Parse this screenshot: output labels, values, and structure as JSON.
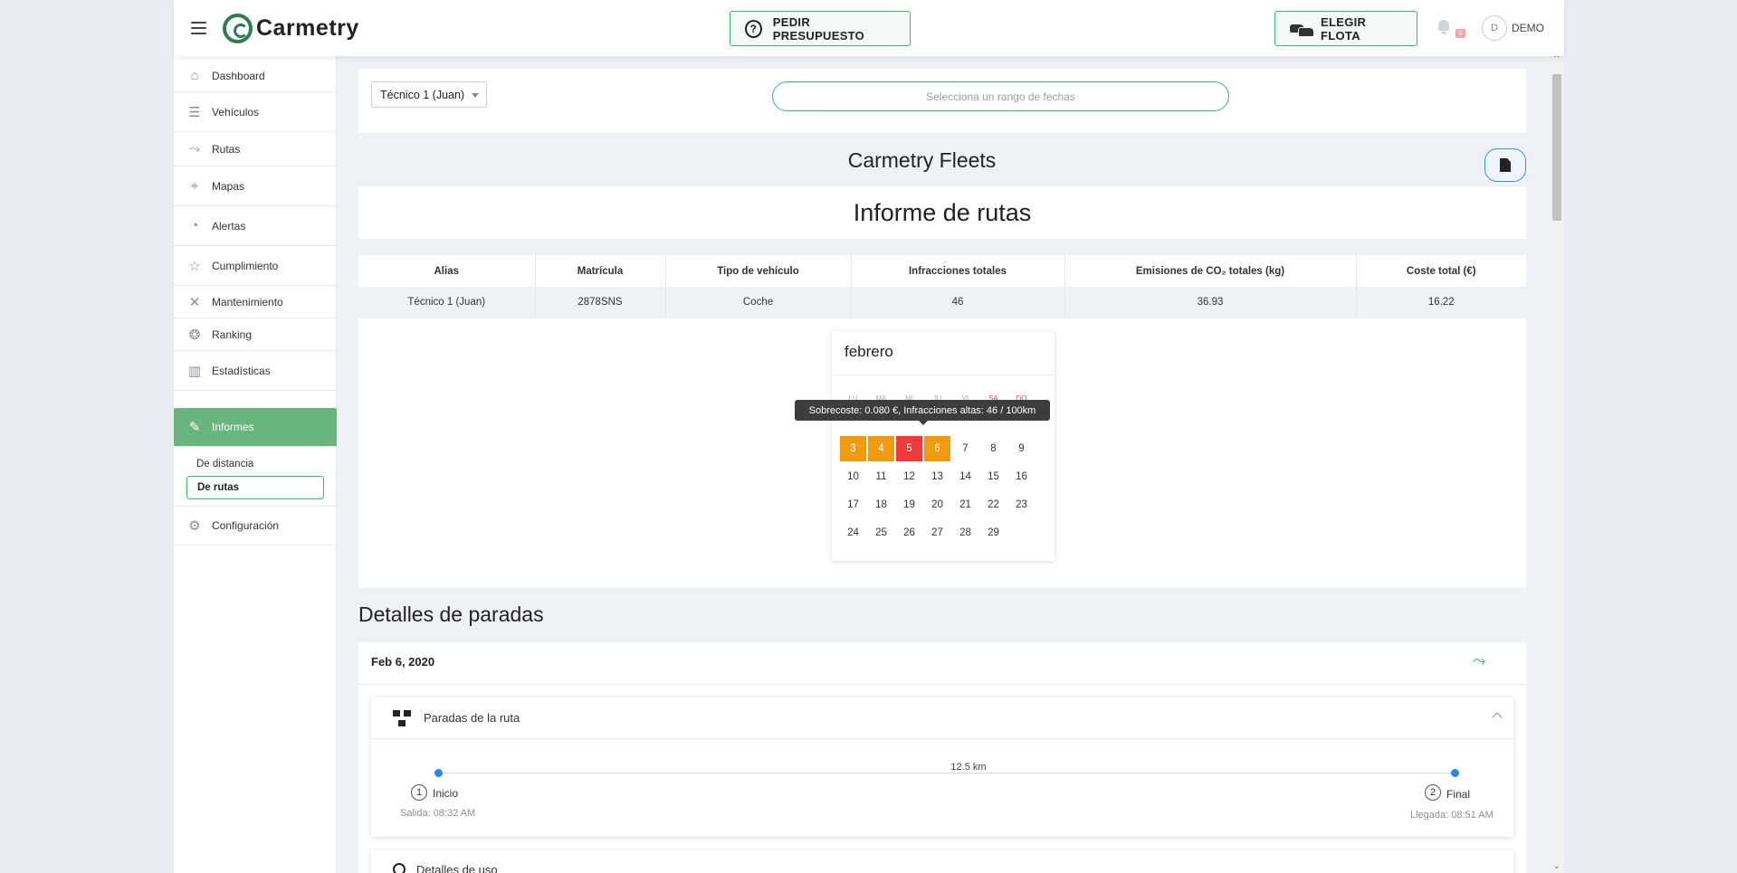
{
  "header": {
    "app_name": "Carmetry",
    "quote_button": "PEDIR PRESUPUESTO",
    "fleet_button": "ELEGIR FLOTA",
    "notification_count": "0",
    "avatar_initial": "D",
    "user_name": "DEMO"
  },
  "sidebar": {
    "items": [
      {
        "label": "Dashboard",
        "icon": "home-icon"
      },
      {
        "label": "Vehículos",
        "icon": "list-icon"
      },
      {
        "label": "Rutas",
        "icon": "route-icon"
      },
      {
        "label": "Mapas",
        "icon": "map-icon"
      },
      {
        "label": "Alertas",
        "icon": "bell-icon"
      },
      {
        "label": "Cumplimiento",
        "icon": "star-icon"
      },
      {
        "label": "Mantenimiento",
        "icon": "wrench-icon"
      },
      {
        "label": "Ranking",
        "icon": "medal-icon"
      },
      {
        "label": "Estadísticas",
        "icon": "chart-icon"
      },
      {
        "label": "Informes",
        "icon": "report-icon"
      },
      {
        "label": "Configuración",
        "icon": "gear-icon"
      }
    ],
    "sub_items": [
      "De distancia",
      "De rutas"
    ]
  },
  "filters": {
    "technician": "Técnico 1 (Juan)",
    "date_placeholder": "Selecciona un rango de fechas"
  },
  "report": {
    "fleet_title": "Carmetry Fleets",
    "title": "Informe de rutas",
    "table": {
      "headers": [
        "Alias",
        "Matrícula",
        "Tipo de vehículo",
        "Infracciones totales",
        "Emisiones de CO₂ totales (kg)",
        "Coste total (€)"
      ],
      "row": [
        "Técnico 1 (Juan)",
        "2878SNS",
        "Coche",
        "46",
        "36.93",
        "16.22"
      ]
    }
  },
  "calendar": {
    "month": "febrero",
    "weekdays": [
      "LU",
      "MA",
      "MI",
      "JU",
      "VI",
      "SA",
      "DO"
    ],
    "weeks": [
      [
        "3",
        "4",
        "5",
        "6",
        "7",
        "8",
        "9"
      ],
      [
        "10",
        "11",
        "12",
        "13",
        "14",
        "15",
        "16"
      ],
      [
        "17",
        "18",
        "19",
        "20",
        "21",
        "22",
        "23"
      ],
      [
        "24",
        "25",
        "26",
        "27",
        "28",
        "29"
      ]
    ],
    "highlight_colors": {
      "orange": "#f19c0f",
      "red": "#ee3a3a"
    },
    "tooltip": "Sobrecoste: 0.080 €, Infracciones altas: 46 / 100km"
  },
  "stops": {
    "heading": "Detalles de paradas",
    "date": "Feb 6, 2020",
    "panel_title": "Paradas de la ruta",
    "distance": "12.5 km",
    "start": {
      "num": "1",
      "label": "Inicio",
      "time": "Salida: 08:32 AM"
    },
    "end": {
      "num": "2",
      "label": "Final",
      "time": "Llegada: 08:51 AM"
    },
    "usage_title": "Detalles de uso"
  },
  "colors": {
    "accent": "#3cba6c",
    "active_nav": "#6ab57f",
    "pdf_border": "#3a8fd9"
  }
}
